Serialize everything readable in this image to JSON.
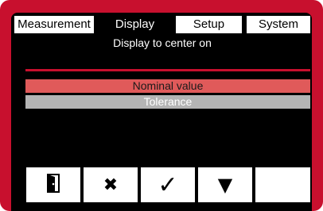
{
  "tabs": [
    {
      "label": "Measurement",
      "active": false
    },
    {
      "label": "Display",
      "active": true
    },
    {
      "label": "Setup",
      "active": false
    },
    {
      "label": "System",
      "active": false
    }
  ],
  "subtitle": "Display to center on",
  "options": [
    {
      "label": "Nominal value",
      "selected": true
    },
    {
      "label": "Tolerance",
      "selected": false
    }
  ],
  "buttons": [
    {
      "icon": "exit-door-icon"
    },
    {
      "icon": "cancel-x-icon",
      "glyph": "✖"
    },
    {
      "icon": "confirm-check-icon",
      "glyph": "✓"
    },
    {
      "icon": "down-arrow-icon",
      "glyph": "▼"
    },
    {
      "icon": "empty"
    }
  ],
  "colors": {
    "frame": "#c8102e",
    "selected_option": "#e05a5a",
    "unselected_option": "#b4b4b4"
  }
}
